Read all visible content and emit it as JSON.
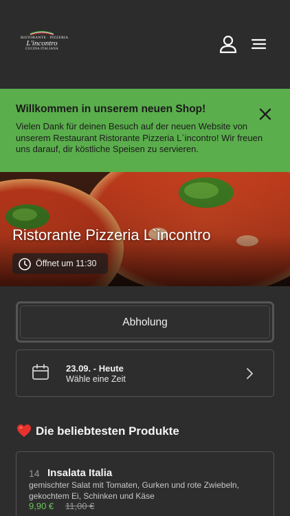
{
  "header": {
    "logo": {
      "line1": "RISTORANTE · PIZZERIA",
      "line2": "L'incontro",
      "line3": "CUCINA ITALIANA"
    },
    "icons": [
      "user-icon",
      "menu-icon"
    ]
  },
  "banner": {
    "title": "Willkommen in unserem neuen Shop!",
    "text": "Vielen Dank für deinen Besuch auf der neuen Website von unserem Restaurant Ristorante Pizzeria L`incontro! Wir freuen uns darauf, dir köstliche Speisen zu servieren.",
    "background": "#5aae4c"
  },
  "hero": {
    "title": "Ristorante Pizzeria L`incontro",
    "opening": "Öffnet um 11:30"
  },
  "order": {
    "mode_label": "Abholung",
    "date_main": "23.09. - Heute",
    "date_sub": "Wähle eine Zeit"
  },
  "popular": {
    "title": "Die beliebtesten Produkte",
    "products": [
      {
        "number": "14",
        "name": "Insalata Italia",
        "description": "gemischter Salat mit Tomaten, Gurken und rote Zwiebeln, gekochtem Ei, Schinken und Käse",
        "price": "9,90 €",
        "old_price": "11,00 €"
      }
    ]
  },
  "colors": {
    "accent_green": "#5aae4c",
    "price_green": "#6cc65a",
    "background": "#2d2d2d"
  }
}
